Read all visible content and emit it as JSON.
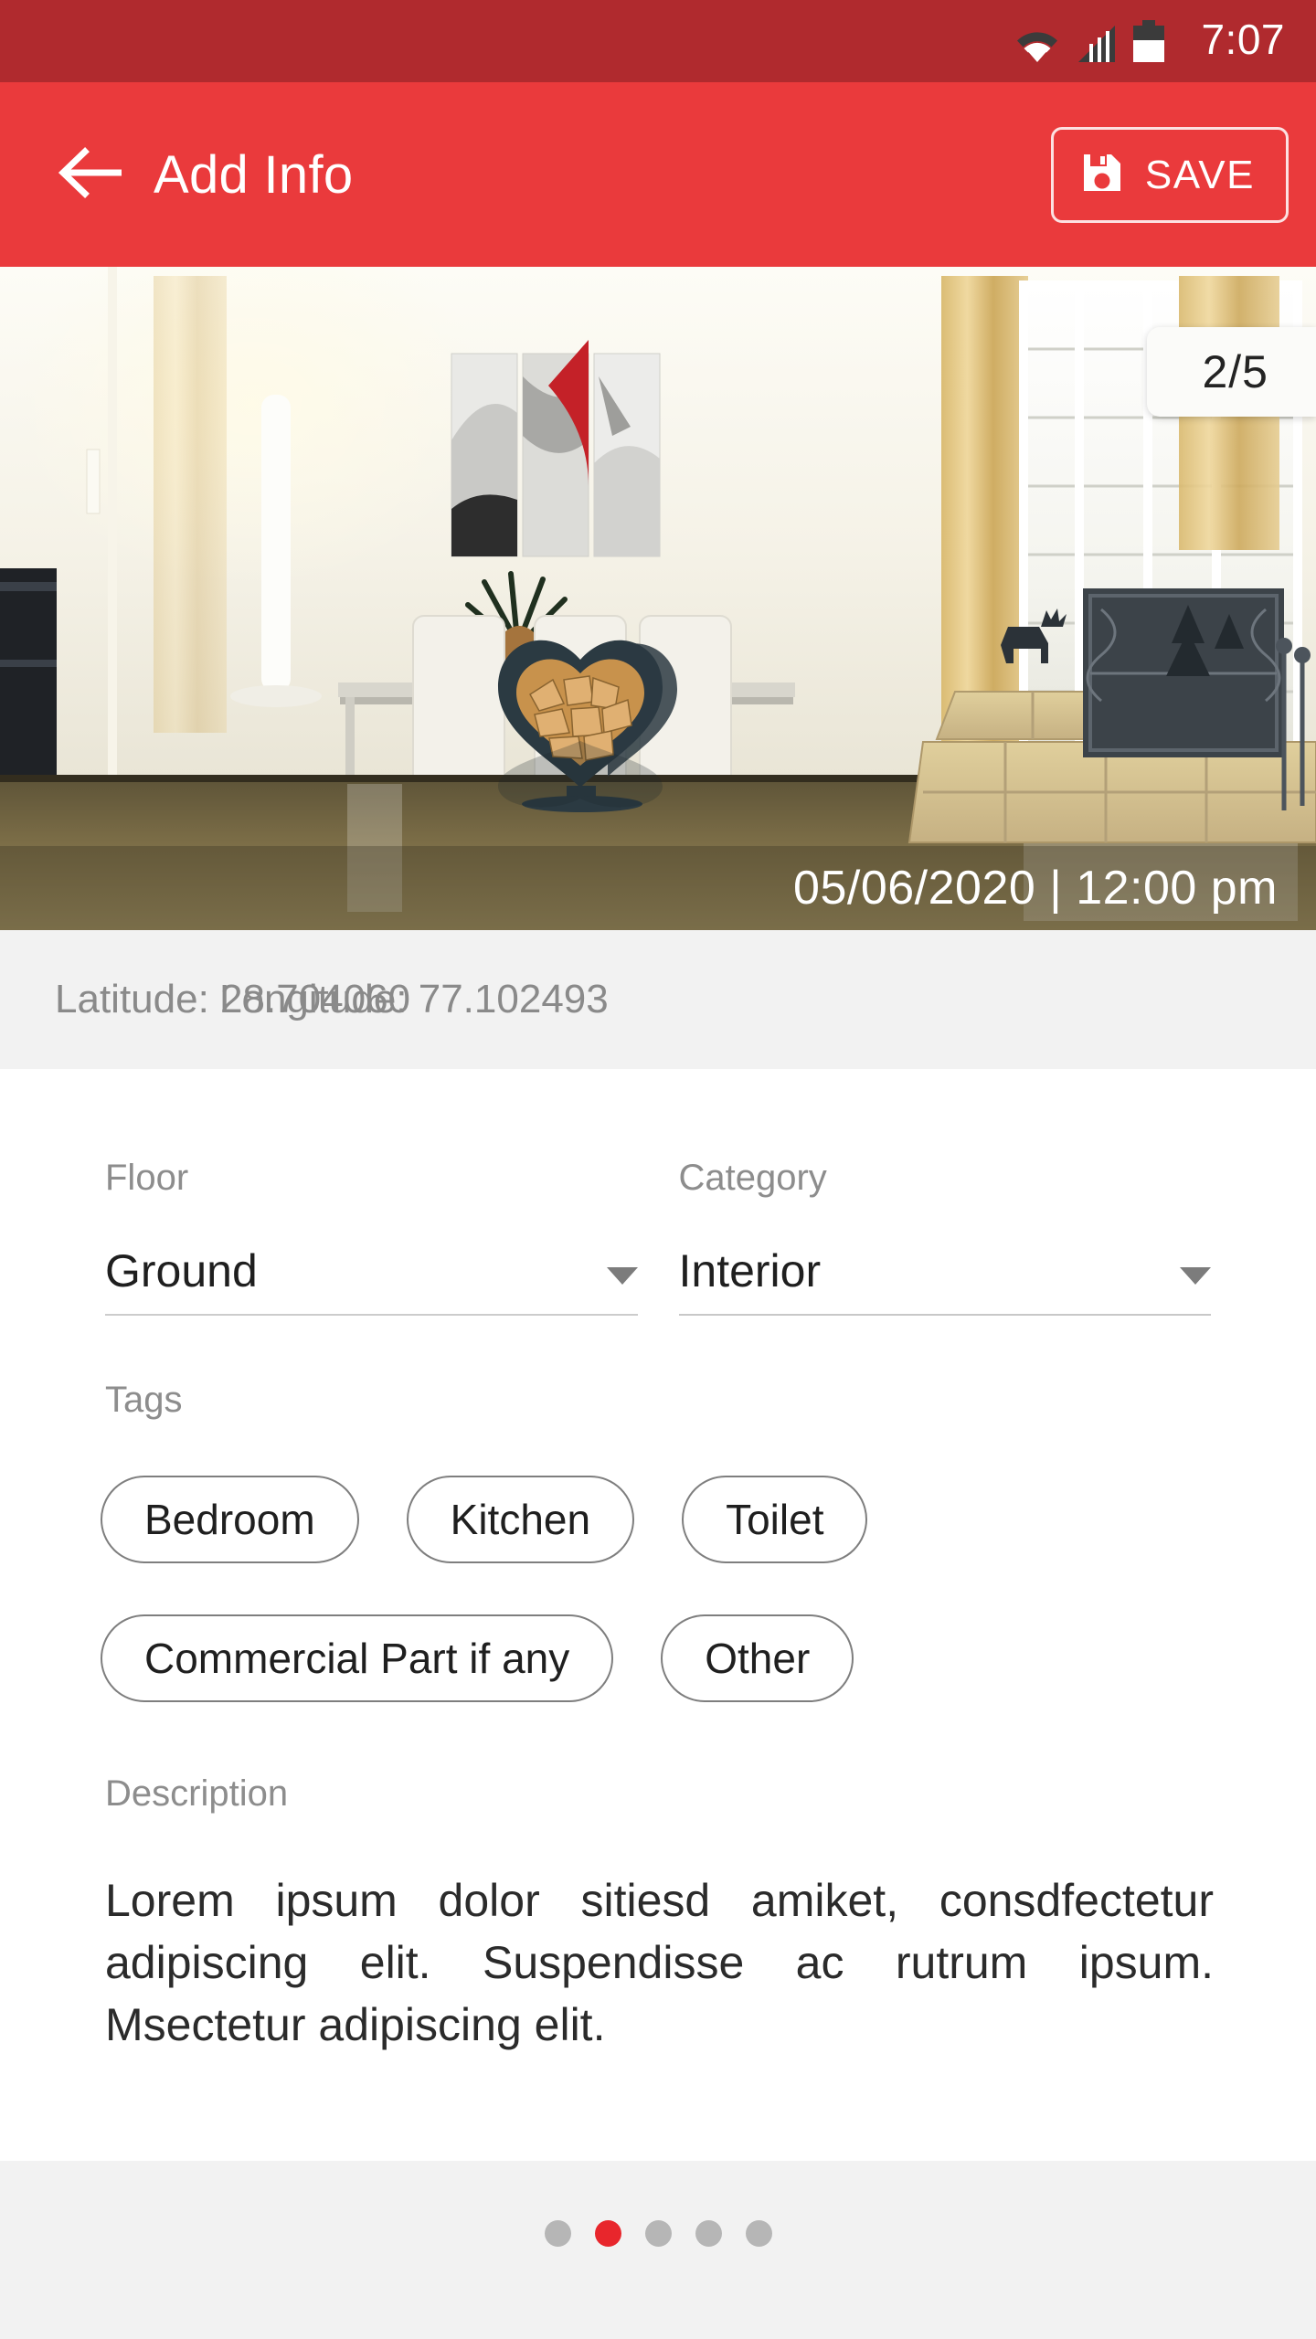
{
  "status_bar": {
    "time": "7:07",
    "icons": [
      "wifi-icon",
      "signal-icon",
      "battery-icon"
    ],
    "background_color": "#b02a2e"
  },
  "app_bar": {
    "back_icon": "back-arrow-icon",
    "title": "Add Info",
    "save_label": "SAVE",
    "save_icon": "floppy-disk-save-icon",
    "background_color": "#ea3a3c"
  },
  "photo": {
    "counter": "2/5",
    "datetime": "05/06/2020 | 12:00 pm",
    "alt": "interior dining room with white chairs, heart-shaped firewood rack and stone fireplace"
  },
  "geo": {
    "latitude_label": "Latitude: 28.704060",
    "longitude_label": "Longitude: 77.102493"
  },
  "form": {
    "floor": {
      "label": "Floor",
      "value": "Ground",
      "caret_icon": "chevron-down-icon"
    },
    "category": {
      "label": "Category",
      "value": "Interior",
      "caret_icon": "chevron-down-icon"
    },
    "tags": {
      "label": "Tags",
      "chips": [
        "Bedroom",
        "Kitchen",
        "Toilet",
        "Commercial Part if any",
        "Other"
      ]
    },
    "description": {
      "label": "Description",
      "text": "Lorem ipsum dolor sitiesd amiket, consdfectetur adipiscing elit. Suspendisse ac rutrum ipsum. Msectetur adipiscing elit."
    }
  },
  "footer": {
    "dot_count": 5,
    "active_index": 1,
    "active_color": "#e8262c",
    "inactive_color": "#b6b6b6"
  }
}
